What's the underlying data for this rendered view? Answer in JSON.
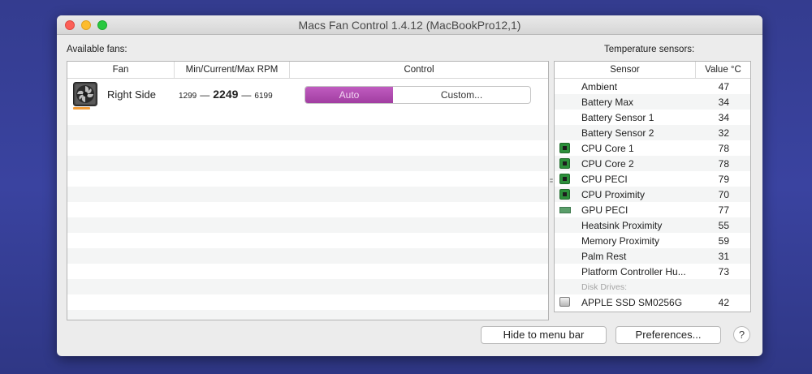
{
  "window": {
    "title": "Macs Fan Control 1.4.12 (MacBookPro12,1)"
  },
  "fans": {
    "label": "Available fans:",
    "columns": {
      "fan": "Fan",
      "rpm": "Min/Current/Max RPM",
      "control": "Control"
    },
    "rows": [
      {
        "name": "Right Side",
        "min": "1299",
        "current": "2249",
        "max": "6199",
        "dash": "—",
        "auto_label": "Auto",
        "custom_label": "Custom..."
      }
    ]
  },
  "temps": {
    "label": "Temperature sensors:",
    "columns": {
      "sensor": "Sensor",
      "value": "Value °C"
    },
    "sensors": [
      {
        "name": "Ambient",
        "value": "47",
        "icon": "none"
      },
      {
        "name": "Battery Max",
        "value": "34",
        "icon": "none"
      },
      {
        "name": "Battery Sensor 1",
        "value": "34",
        "icon": "none"
      },
      {
        "name": "Battery Sensor 2",
        "value": "32",
        "icon": "none"
      },
      {
        "name": "CPU Core 1",
        "value": "78",
        "icon": "cpu-chip-icon"
      },
      {
        "name": "CPU Core 2",
        "value": "78",
        "icon": "cpu-chip-icon"
      },
      {
        "name": "CPU PECI",
        "value": "79",
        "icon": "cpu-chip-icon"
      },
      {
        "name": "CPU Proximity",
        "value": "70",
        "icon": "cpu-chip-icon"
      },
      {
        "name": "GPU PECI",
        "value": "77",
        "icon": "gpu-card-icon"
      },
      {
        "name": "Heatsink Proximity",
        "value": "55",
        "icon": "none"
      },
      {
        "name": "Memory Proximity",
        "value": "59",
        "icon": "none"
      },
      {
        "name": "Palm Rest",
        "value": "31",
        "icon": "none"
      },
      {
        "name": "Platform Controller Hu...",
        "value": "73",
        "icon": "none"
      }
    ],
    "disk_section": "Disk Drives:",
    "disks": [
      {
        "name": "APPLE SSD SM0256G",
        "value": "42",
        "icon": "ssd-drive-icon"
      }
    ]
  },
  "buttons": {
    "hide": "Hide to menu bar",
    "preferences": "Preferences...",
    "help": "?"
  },
  "colors": {
    "auto_segment": "#b14cb1",
    "chip_green": "#2c8f3a",
    "fan_accent": "#f29c38"
  }
}
